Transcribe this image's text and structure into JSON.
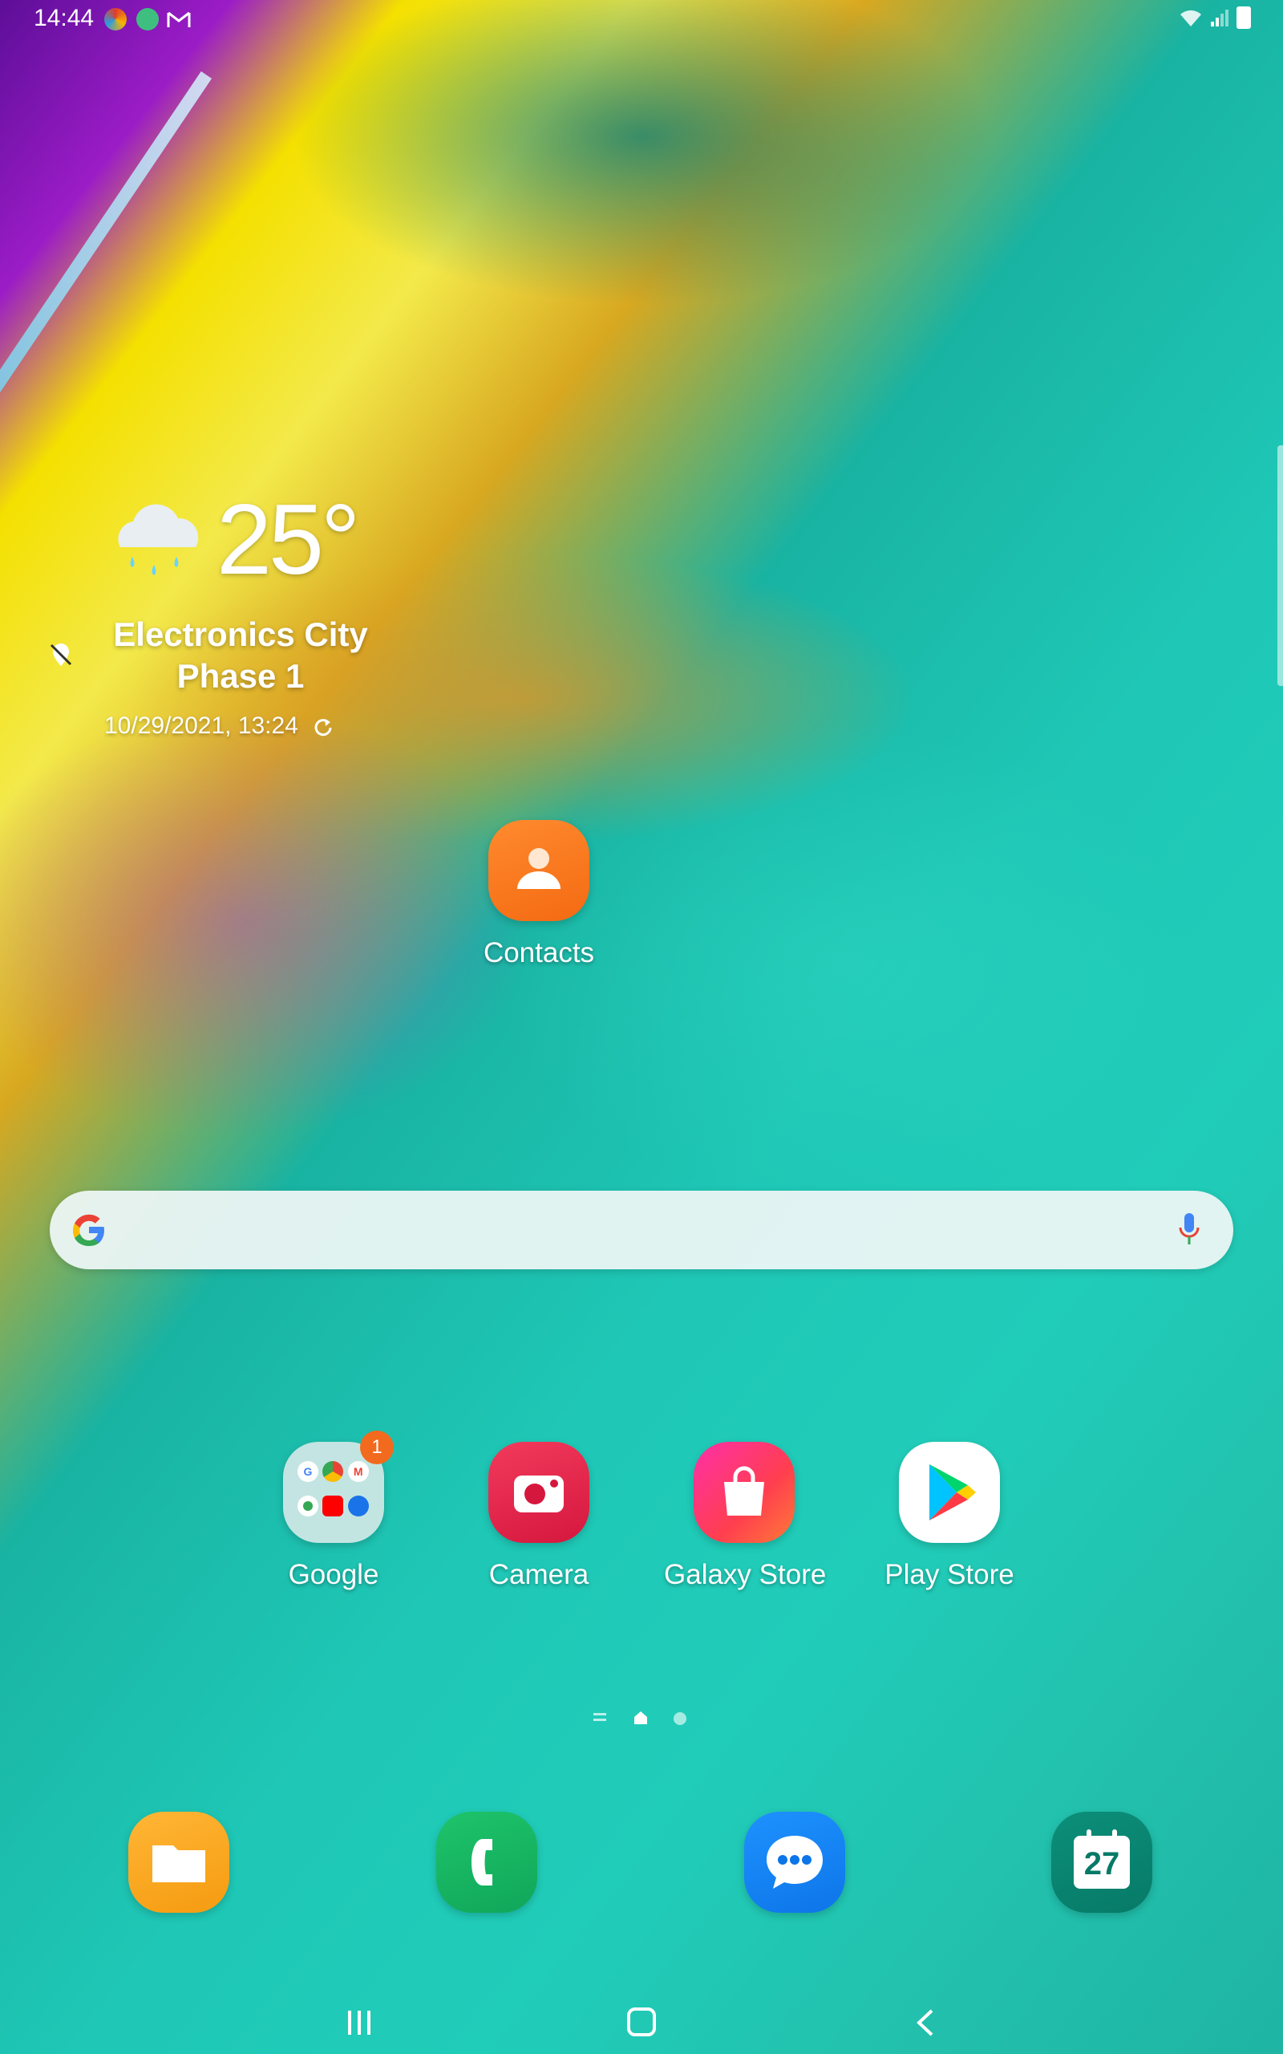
{
  "status_bar": {
    "time": "14:44",
    "left_icons": [
      "browser-notification-icon",
      "android-notification-icon",
      "gmail-icon"
    ],
    "right_icons": [
      "wifi-icon",
      "signal-icon",
      "battery-icon"
    ]
  },
  "weather": {
    "temperature": "25°",
    "location": "Electronics City Phase 1",
    "updated": "10/29/2021, 13:24",
    "condition_icon": "rain-cloud-icon"
  },
  "apps": {
    "contacts": {
      "label": "Contacts"
    },
    "google": {
      "label": "Google",
      "badge": "1"
    },
    "camera": {
      "label": "Camera"
    },
    "galaxy_store": {
      "label": "Galaxy Store"
    },
    "play_store": {
      "label": "Play Store"
    }
  },
  "dock": {
    "calendar_date": "27",
    "items": [
      "my-files-icon",
      "phone-icon",
      "messages-icon",
      "calendar-icon"
    ]
  },
  "pager": {
    "pages": 2,
    "current": "home"
  },
  "colors": {
    "accent": "#20cdb9",
    "badge": "#f26a1d"
  }
}
